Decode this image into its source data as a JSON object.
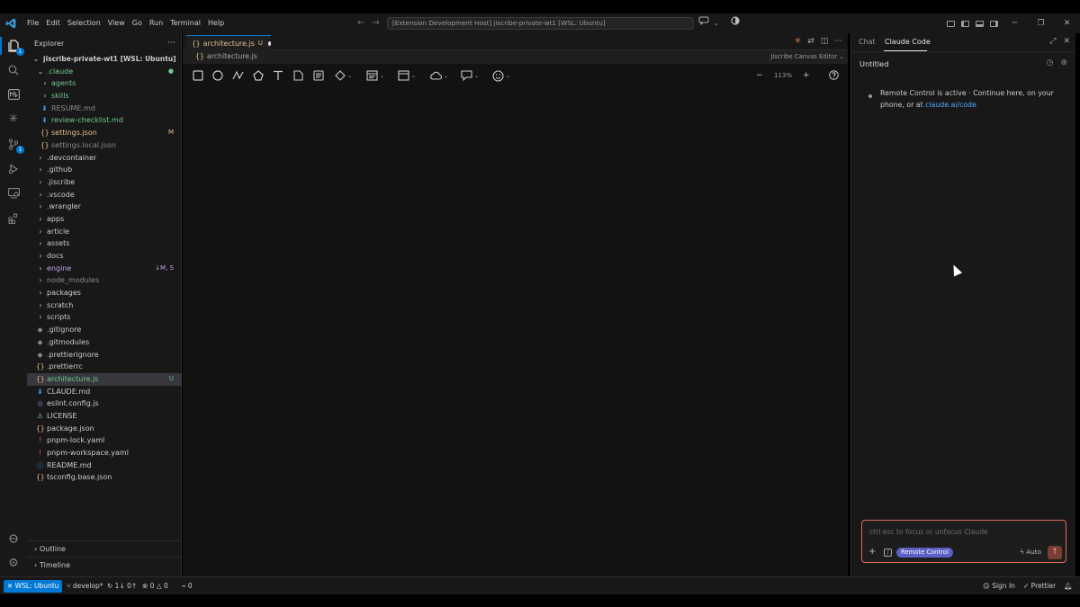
{
  "menu": [
    "File",
    "Edit",
    "Selection",
    "View",
    "Go",
    "Run",
    "Terminal",
    "Help"
  ],
  "command_center": "[Extension Development Host] jiscribe-private-wt1 [WSL: Ubuntu]",
  "activity_badges": {
    "explorer": "1",
    "source_control": "1"
  },
  "explorer": {
    "title": "Explorer",
    "more": "···",
    "root": "jiscribe-private-wt1 [WSL: Ubuntu]",
    "rows": [
      {
        "label": ".claude",
        "deco": "●"
      },
      {
        "label": "agents"
      },
      {
        "label": "skills"
      },
      {
        "label": "RESUME.md"
      },
      {
        "label": "review-checklist.md"
      },
      {
        "label": "settings.json",
        "deco": "M"
      },
      {
        "label": "settings.local.json"
      },
      {
        "label": ".devcontainer"
      },
      {
        "label": ".github"
      },
      {
        "label": ".jiscribe"
      },
      {
        "label": ".vscode"
      },
      {
        "label": ".wrangler"
      },
      {
        "label": "apps"
      },
      {
        "label": "article"
      },
      {
        "label": "assets"
      },
      {
        "label": "docs"
      },
      {
        "label": "engine",
        "deco": "↓M, S"
      },
      {
        "label": "node_modules"
      },
      {
        "label": "packages"
      },
      {
        "label": "scratch"
      },
      {
        "label": "scripts"
      },
      {
        "label": ".gitignore"
      },
      {
        "label": ".gitmodules"
      },
      {
        "label": ".prettierignore"
      },
      {
        "label": ".prettierrc"
      },
      {
        "label": "architecture.js",
        "deco": "U"
      },
      {
        "label": "CLAUDE.md"
      },
      {
        "label": "eslint.config.js"
      },
      {
        "label": "LICENSE"
      },
      {
        "label": "package.json"
      },
      {
        "label": "pnpm-lock.yaml"
      },
      {
        "label": "pnpm-workspace.yaml"
      },
      {
        "label": "README.md"
      },
      {
        "label": "tsconfig.base.json"
      }
    ],
    "outline": "Outline",
    "timeline": "Timeline"
  },
  "editor": {
    "tab_label": "architecture.js",
    "tab_status": "U",
    "breadcrumb": "architecture.js",
    "editor_name": "Jiscribe Canvas Editor",
    "zoom": "113%"
  },
  "panel": {
    "tabs": [
      "Chat",
      "Claude Code"
    ],
    "session_title": "Untitled",
    "message_text": "Remote Control is active · Continue here, on your phone, or at ",
    "message_link": "claude.ai/code",
    "chat_placeholder": "ctrl esc to focus or unfocus Claude",
    "remote_pill": "Remote Control",
    "mode": "Auto"
  },
  "status": {
    "remote": "WSL: Ubuntu",
    "branch": "develop*",
    "sync": "1↓ 0↑",
    "errors": "0",
    "warnings": "0",
    "ports": "0",
    "sign_in": "Sign In",
    "prettier": "Prettier"
  },
  "colors": {
    "accent": "#0078d4",
    "untracked": "#73c991",
    "modified": "#e2c08d",
    "link": "#4daafc",
    "chat_border": "#e06c5a",
    "pill": "#5b5fc7"
  }
}
